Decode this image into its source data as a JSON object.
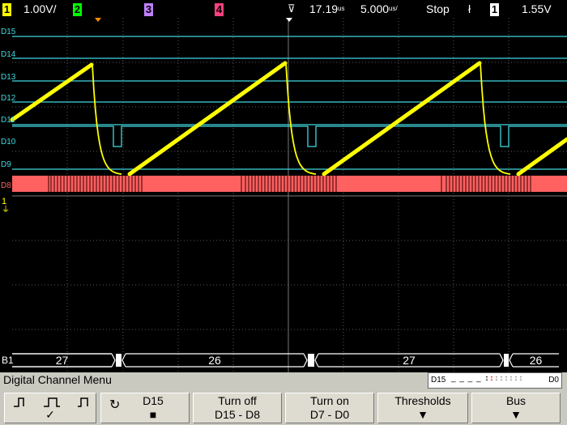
{
  "status": {
    "ch1_num": "1",
    "ch1_scale": "1.00V/",
    "ch2_num": "2",
    "ch3_num": "3",
    "ch4_num": "4",
    "time_ref": "17.19",
    "time_ref_unit": "us",
    "time_scale": "5.000",
    "time_scale_unit": "us/",
    "run_state": "Stop",
    "trig_slope_icon": "falling-edge-icon",
    "trig_source": "1",
    "trig_level": "1.55V"
  },
  "colors": {
    "ch1": "#ffff00",
    "ch2": "#00ff00",
    "ch3": "#c080ff",
    "ch4": "#ff4080",
    "digital": "#40d8e0",
    "d8_bus": "#ff6060",
    "grid": "#585858",
    "menu_bg": "#c9c9c0",
    "softkey_bg": "#dedbd0"
  },
  "digital_labels": [
    "D15",
    "D14",
    "D13",
    "D12",
    "D11",
    "D10",
    "D9",
    "D8"
  ],
  "bus": {
    "label": "B1",
    "values": [
      "27",
      "26",
      "27",
      "26"
    ]
  },
  "menu": {
    "title": "Digital Channel Menu",
    "mini_legend_left": "D15",
    "mini_legend_right": "D0",
    "softkeys": [
      {
        "name": "threshold-pulse-icons",
        "l1": "",
        "l2": "✓"
      },
      {
        "name": "channel-select",
        "l1": "D15",
        "l2": "■"
      },
      {
        "name": "turn-off-d15-d8",
        "l1": "Turn off",
        "l2": "D15 - D8"
      },
      {
        "name": "turn-on-d7-d0",
        "l1": "Turn on",
        "l2": "D7 - D0"
      },
      {
        "name": "thresholds",
        "l1": "Thresholds",
        "l2": "▼"
      },
      {
        "name": "bus",
        "l1": "Bus",
        "l2": "▼"
      }
    ]
  }
}
